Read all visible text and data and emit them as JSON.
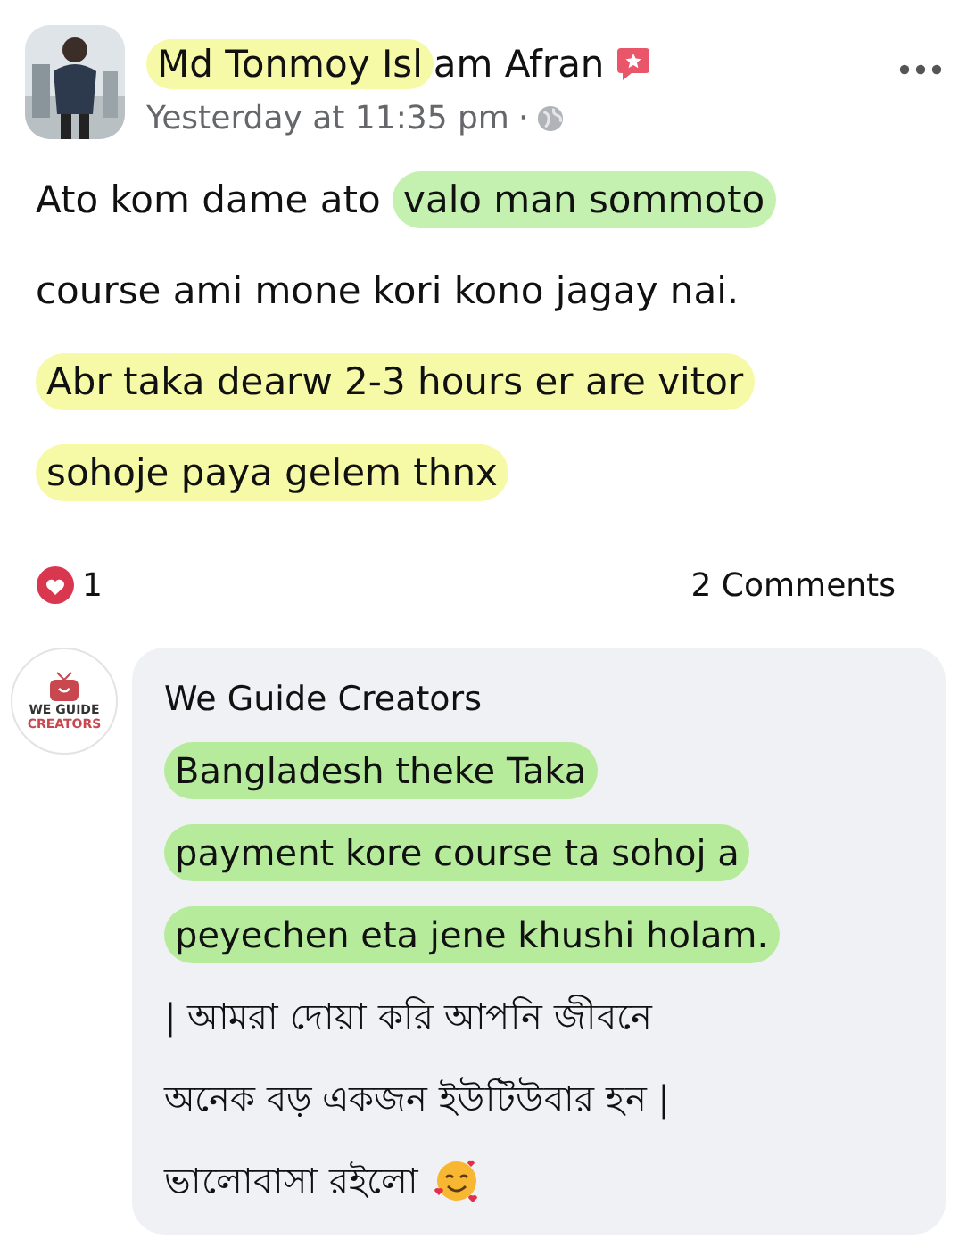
{
  "post": {
    "author": [
      {
        "text": "Md Tonmoy Isl",
        "color": "#f6f9a6"
      },
      {
        "text": "am Afran"
      }
    ],
    "time": "Yesterday at 11:35 pm",
    "separator": "·",
    "body": [
      [
        {
          "text": "Ato kom dame ato "
        },
        {
          "text": "valo man sommoto",
          "color": "#c4f0b0"
        }
      ],
      [
        {
          "text": "course ami mone kori kono jagay nai."
        }
      ],
      [
        {
          "text": "Abr taka dearw 2-3 hours er are vitor",
          "color": "#f6f9a6"
        }
      ],
      [
        {
          "text": "sohoje paya gelem thnx",
          "color": "#f6f9a6"
        }
      ]
    ],
    "reactions": "1",
    "comments_count": "2 Comments"
  },
  "comment": {
    "logo_text": [
      "WE GUIDE",
      "CREATORS"
    ],
    "author": "We Guide Creators",
    "body": [
      [
        {
          "text": "Bangladesh theke Taka",
          "color": "#b6eb9c"
        }
      ],
      [
        {
          "text": "payment kore course ta sohoj a",
          "color": "#b6eb9c"
        }
      ],
      [
        {
          "text": "peyechen eta jene khushi holam.",
          "color": "#b6eb9c"
        }
      ],
      [
        {
          "text": "| আমরা দোয়া করি আপনি জীবনে"
        }
      ],
      [
        {
          "text": "অনেক বড় একজন ইউটিউবার হন |"
        }
      ],
      [
        {
          "text": "ভালোবাসা রইলো"
        }
      ]
    ]
  }
}
